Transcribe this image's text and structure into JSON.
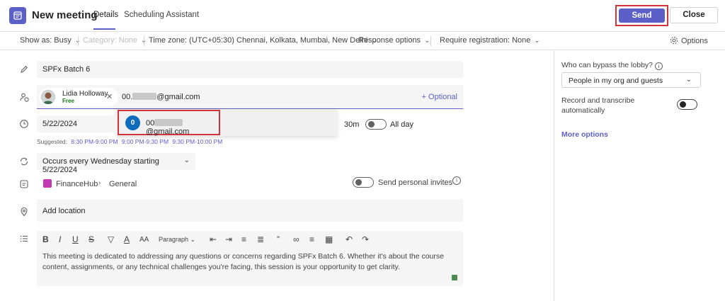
{
  "header": {
    "title": "New meeting",
    "tabs": [
      {
        "label": "Details",
        "active": true
      },
      {
        "label": "Scheduling Assistant",
        "active": false
      }
    ],
    "send_label": "Send",
    "close_label": "Close"
  },
  "options_bar": {
    "show_as": "Show as: Busy",
    "category": "Category: None",
    "time_zone": "Time zone: (UTC+05:30) Chennai, Kolkata, Mumbai, New Delhi",
    "response_options": "Response options",
    "require_registration": "Require registration: None",
    "options_label": "Options"
  },
  "form": {
    "title_value": "SPFx Batch 6",
    "attendee": {
      "name": "Lidia Holloway",
      "status": "Free"
    },
    "attendee_typed_prefix": "00.",
    "attendee_typed_suffix": "@gmail.com",
    "optional_label": "+ Optional",
    "suggestion": {
      "initial": "0",
      "prefix": "00",
      "suffix": "@gmail.com"
    },
    "start_date": "5/22/2024",
    "duration_fragment": "30m",
    "all_day_label": "All day",
    "suggested_label": "Suggested:",
    "suggested_times": [
      "8:30 PM-9:00 PM",
      "9:00 PM-9:30 PM",
      "9:30 PM-10:00 PM"
    ],
    "recurrence": "Occurs every Wednesday starting 5/22/2024",
    "channel_team": "FinanceHub",
    "channel_name": "General",
    "send_personal_invites": "Send personal invites",
    "location_placeholder": "Add location",
    "editor_paragraph": "Paragraph",
    "body": "This meeting is dedicated to addressing any questions or concerns regarding SPFx Batch 6. Whether it's about the course content, assignments, or any technical challenges you're facing, this session is your opportunity to get clarity."
  },
  "right_panel": {
    "lobby_label": "Who can bypass the lobby?",
    "lobby_value": "People in my org and guests",
    "record_label": "Record and transcribe automatically",
    "more_options": "More options"
  },
  "colors": {
    "accent": "#5b5fc7",
    "highlight": "#d13438",
    "free": "#107c10"
  }
}
